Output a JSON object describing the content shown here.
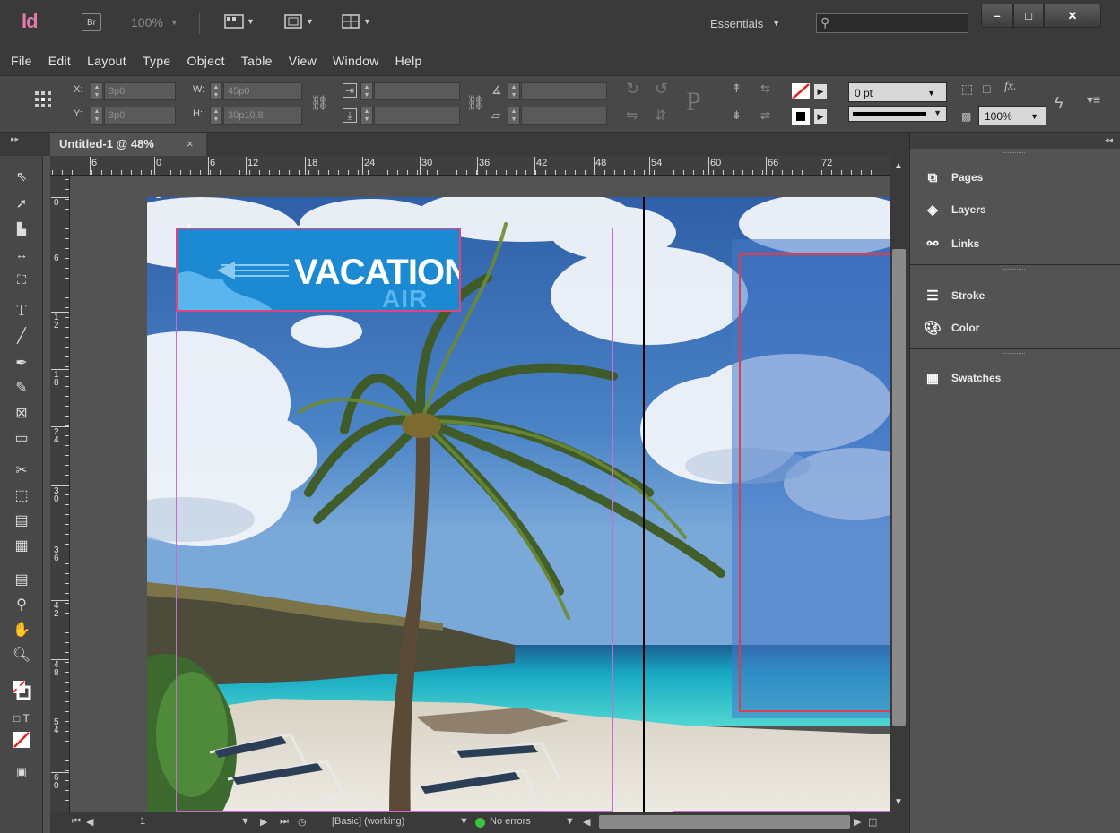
{
  "app": {
    "logo": "Id",
    "bridge_label": "Br",
    "zoom_value": "100%",
    "workspace": "Essentials",
    "search_placeholder": ""
  },
  "window_controls": {
    "minimize": "–",
    "maximize": "□",
    "close": "✕"
  },
  "menu": [
    "File",
    "Edit",
    "Layout",
    "Type",
    "Object",
    "Table",
    "View",
    "Window",
    "Help"
  ],
  "control_panel": {
    "x_label": "X:",
    "x_value": "3p0",
    "y_label": "Y:",
    "y_value": "3p0",
    "w_label": "W:",
    "w_value": "45p0",
    "h_label": "H:",
    "h_value": "30p10.8",
    "stroke_weight": "0 pt",
    "opacity": "100%"
  },
  "document": {
    "tab_title": "Untitled-1 @ 48%",
    "tab_close": "×",
    "logo_text": "VACATION",
    "logo_subtext": "AIR"
  },
  "rulers": {
    "horizontal": [
      "6",
      "0",
      "6",
      "12",
      "18",
      "24",
      "30",
      "36",
      "42",
      "48",
      "54",
      "60",
      "66",
      "72"
    ],
    "vertical": [
      "0",
      "6",
      "12",
      "18",
      "24",
      "30",
      "36",
      "42",
      "48",
      "54",
      "60"
    ]
  },
  "status": {
    "page_number": "1",
    "master": "[Basic] (working)",
    "preflight": "No errors"
  },
  "panels": {
    "group1": [
      {
        "label": "Pages",
        "icon": "pages-icon"
      },
      {
        "label": "Layers",
        "icon": "layers-icon"
      },
      {
        "label": "Links",
        "icon": "links-icon"
      }
    ],
    "group2": [
      {
        "label": "Stroke",
        "icon": "stroke-icon"
      },
      {
        "label": "Color",
        "icon": "color-icon"
      }
    ],
    "group3": [
      {
        "label": "Swatches",
        "icon": "swatches-icon"
      }
    ]
  },
  "colors": {
    "logo_blue": "#1b8ad2",
    "frame_red": "#e0447a",
    "margin_guide": "#c86bd8"
  }
}
